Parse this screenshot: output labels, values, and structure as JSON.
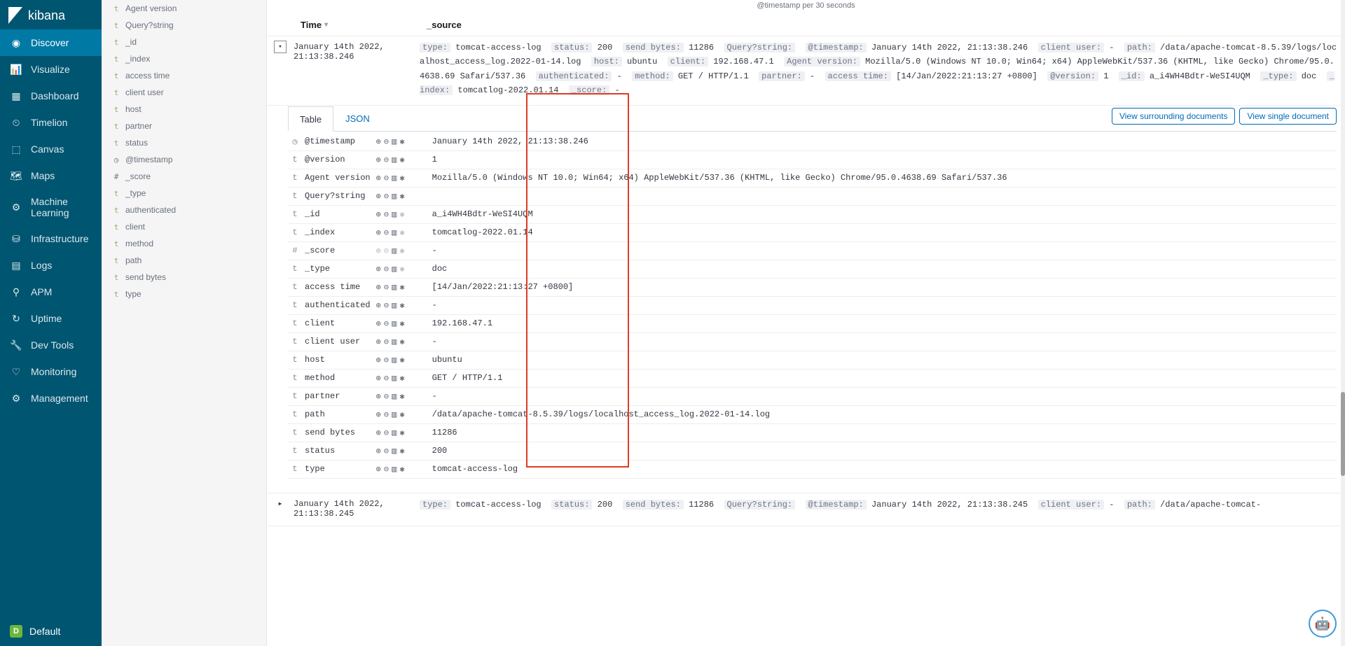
{
  "brand": "kibana",
  "xaxis_caption": "@timestamp per 30 seconds",
  "nav": [
    {
      "label": "Discover",
      "active": true
    },
    {
      "label": "Visualize"
    },
    {
      "label": "Dashboard"
    },
    {
      "label": "Timelion"
    },
    {
      "label": "Canvas"
    },
    {
      "label": "Maps"
    },
    {
      "label": "Machine Learning"
    },
    {
      "label": "Infrastructure"
    },
    {
      "label": "Logs"
    },
    {
      "label": "APM"
    },
    {
      "label": "Uptime"
    },
    {
      "label": "Dev Tools"
    },
    {
      "label": "Monitoring"
    },
    {
      "label": "Management"
    }
  ],
  "footer_badge": "D",
  "footer_label": "Default",
  "fields": [
    {
      "type": "t",
      "name": "Agent version"
    },
    {
      "type": "t",
      "name": "Query?string"
    },
    {
      "type": "t",
      "name": "_id"
    },
    {
      "type": "t",
      "name": "_index"
    },
    {
      "type": "t",
      "name": "access time"
    },
    {
      "type": "t",
      "name": "client user"
    },
    {
      "type": "t",
      "name": "host"
    },
    {
      "type": "t",
      "name": "partner"
    },
    {
      "type": "t",
      "name": "status"
    },
    {
      "type": "clock",
      "name": "@timestamp"
    },
    {
      "type": "#",
      "name": "_score"
    },
    {
      "type": "t",
      "name": "_type"
    },
    {
      "type": "t",
      "name": "authenticated"
    },
    {
      "type": "t",
      "name": "client"
    },
    {
      "type": "t",
      "name": "method"
    },
    {
      "type": "t",
      "name": "path"
    },
    {
      "type": "t",
      "name": "send bytes"
    },
    {
      "type": "t",
      "name": "type"
    }
  ],
  "doc_header": {
    "time": "Time",
    "source": "_source"
  },
  "row1": {
    "time": "January 14th 2022, 21:13:38.246",
    "source_pairs": [
      [
        "type:",
        "tomcat-access-log"
      ],
      [
        "status:",
        "200"
      ],
      [
        "send bytes:",
        "11286"
      ],
      [
        "Query?string:",
        ""
      ],
      [
        "@timestamp:",
        "January 14th 2022, 21:13:38.246"
      ],
      [
        "client user:",
        "-"
      ],
      [
        "path:",
        "/data/apache-tomcat-8.5.39/logs/localhost_access_log.2022-01-14.log"
      ],
      [
        "host:",
        "ubuntu"
      ],
      [
        "client:",
        "192.168.47.1"
      ],
      [
        "Agent version:",
        "Mozilla/5.0 (Windows NT 10.0; Win64; x64) AppleWebKit/537.36 (KHTML, like Gecko) Chrome/95.0.4638.69 Safari/537.36"
      ],
      [
        "authenticated:",
        "-"
      ],
      [
        "method:",
        "GET / HTTP/1.1"
      ],
      [
        "partner:",
        "-"
      ],
      [
        "access time:",
        "[14/Jan/2022:21:13:27 +0800]"
      ],
      [
        "@version:",
        "1"
      ],
      [
        "_id:",
        "a_i4WH4Bdtr-WeSI4UQM"
      ],
      [
        "_type:",
        "doc"
      ],
      [
        "_index:",
        "tomcatlog-2022.01.14"
      ],
      [
        "_score:",
        " -"
      ]
    ]
  },
  "tabs": {
    "table": "Table",
    "json": "JSON"
  },
  "actions": {
    "surrounding": "View surrounding documents",
    "single": "View single document"
  },
  "details": [
    {
      "type": "clock",
      "name": "@timestamp",
      "value": "January 14th 2022, 21:13:38.246",
      "gray_star": false
    },
    {
      "type": "t",
      "name": "@version",
      "value": "1",
      "gray_star": false
    },
    {
      "type": "t",
      "name": "Agent version",
      "value": "Mozilla/5.0 (Windows NT 10.0; Win64; x64) AppleWebKit/537.36 (KHTML, like Gecko) Chrome/95.0.4638.69 Safari/537.36",
      "gray_star": false
    },
    {
      "type": "t",
      "name": "Query?string",
      "value": "",
      "gray_star": false
    },
    {
      "type": "t",
      "name": "_id",
      "value": "a_i4WH4Bdtr-WeSI4UQM",
      "gray_star": true
    },
    {
      "type": "t",
      "name": "_index",
      "value": "tomcatlog-2022.01.14",
      "gray_star": true
    },
    {
      "type": "#",
      "name": "_score",
      "value": " - ",
      "gray_all": true
    },
    {
      "type": "t",
      "name": "_type",
      "value": "doc",
      "gray_star": true
    },
    {
      "type": "t",
      "name": "access time",
      "value": "[14/Jan/2022:21:13:27 +0800]",
      "gray_star": false
    },
    {
      "type": "t",
      "name": "authenticated",
      "value": "-",
      "gray_star": false
    },
    {
      "type": "t",
      "name": "client",
      "value": "192.168.47.1",
      "gray_star": false
    },
    {
      "type": "t",
      "name": "client user",
      "value": "-",
      "gray_star": false
    },
    {
      "type": "t",
      "name": "host",
      "value": "ubuntu",
      "gray_star": false
    },
    {
      "type": "t",
      "name": "method",
      "value": "GET / HTTP/1.1",
      "gray_star": false
    },
    {
      "type": "t",
      "name": "partner",
      "value": "-",
      "gray_star": false
    },
    {
      "type": "t",
      "name": "path",
      "value": "/data/apache-tomcat-8.5.39/logs/localhost_access_log.2022-01-14.log",
      "gray_star": false
    },
    {
      "type": "t",
      "name": "send bytes",
      "value": "11286",
      "gray_star": false
    },
    {
      "type": "t",
      "name": "status",
      "value": "200",
      "gray_star": false
    },
    {
      "type": "t",
      "name": "type",
      "value": "tomcat-access-log",
      "gray_star": false
    }
  ],
  "row2": {
    "time": "January 14th 2022, 21:13:38.245",
    "source_pairs": [
      [
        "type:",
        "tomcat-access-log"
      ],
      [
        "status:",
        "200"
      ],
      [
        "send bytes:",
        "11286"
      ],
      [
        "Query?string:",
        ""
      ],
      [
        "@timestamp:",
        "January 14th 2022, 21:13:38.245"
      ],
      [
        "client user:",
        "-"
      ],
      [
        "path:",
        "/data/apache-tomcat-"
      ]
    ]
  }
}
